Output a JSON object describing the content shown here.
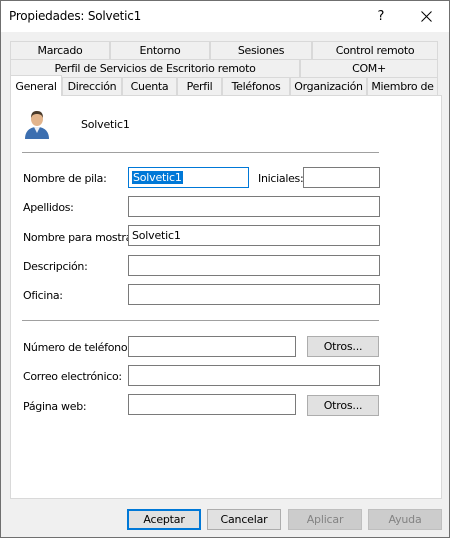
{
  "window": {
    "title": "Propiedades: Solvetic1",
    "help_glyph": "?"
  },
  "tabs": {
    "row1": [
      "Marcado",
      "Entorno",
      "Sesiones",
      "Control remoto"
    ],
    "row2": [
      "Perfil de Servicios de Escritorio remoto",
      "COM+"
    ],
    "row3": [
      "General",
      "Dirección",
      "Cuenta",
      "Perfil",
      "Teléfonos",
      "Organización",
      "Miembro de"
    ],
    "active": "General"
  },
  "general": {
    "user_display": "Solvetic1",
    "avatar_icon": "user-icon",
    "labels": {
      "first_name": "Nombre de pila:",
      "initials": "Iniciales:",
      "last_name": "Apellidos:",
      "display_name": "Nombre para mostrar:",
      "description": "Descripción:",
      "office": "Oficina:",
      "phone": "Número de teléfono:",
      "email": "Correo electrónico:",
      "web": "Página web:"
    },
    "values": {
      "first_name": "Solvetic1",
      "initials": "",
      "last_name": "",
      "display_name": "Solvetic1",
      "description": "",
      "office": "",
      "phone": "",
      "email": "",
      "web": ""
    },
    "others_phone": "Otros...",
    "others_web": "Otros..."
  },
  "footer": {
    "ok": "Aceptar",
    "cancel": "Cancelar",
    "apply": "Aplicar",
    "help": "Ayuda"
  },
  "colors": {
    "accent": "#0078d7",
    "panel": "#ffffff",
    "chrome": "#f0f0f0"
  }
}
